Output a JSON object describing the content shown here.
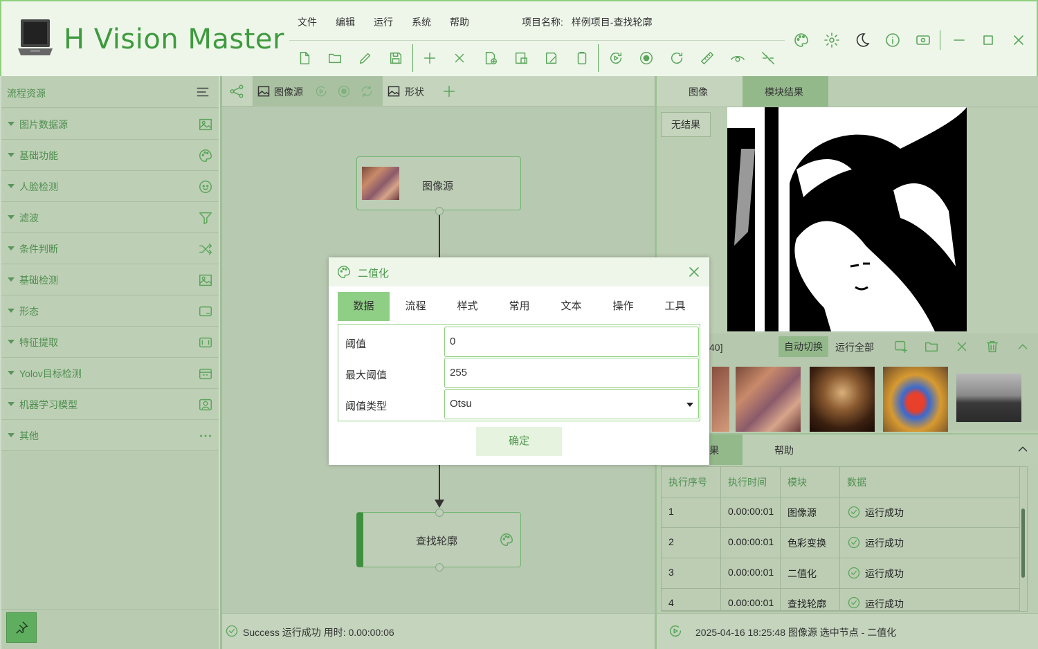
{
  "app": {
    "title": "H Vision Master",
    "project_label": "项目名称:",
    "project_name": "样例项目-查找轮廓"
  },
  "menu": [
    "文件",
    "编辑",
    "运行",
    "系统",
    "帮助"
  ],
  "left_panel": {
    "title": "流程资源",
    "categories": [
      "图片数据源",
      "基础功能",
      "人脸检测",
      "滤波",
      "条件判断",
      "基础检测",
      "形态",
      "特征提取",
      "Yolov目标检测",
      "机器学习模型",
      "其他"
    ]
  },
  "center": {
    "tabs": [
      "图像源",
      "形状"
    ],
    "nodes": {
      "source": "图像源",
      "find_contour": "查找轮廓"
    },
    "status": "Success 运行成功 用时: 0.00:00:06"
  },
  "right": {
    "tabs": [
      "图像",
      "模块结果"
    ],
    "no_result": "无结果",
    "counter": "40]",
    "auto_switch": "自动切换",
    "run_all": "运行全部",
    "result_tabs": [
      "果",
      "帮助"
    ],
    "table": {
      "headers": [
        "执行序号",
        "执行时间",
        "模块",
        "数据"
      ],
      "rows": [
        [
          "1",
          "0.00:00:01",
          "图像源",
          "运行成功"
        ],
        [
          "2",
          "0.00:00:01",
          "色彩变换",
          "运行成功"
        ],
        [
          "3",
          "0.00:00:01",
          "二值化",
          "运行成功"
        ],
        [
          "4",
          "0.00:00:01",
          "查找轮廓",
          "运行成功"
        ]
      ]
    },
    "status": "2025-04-16 18:25:48 图像源 选中节点 - 二值化"
  },
  "dialog": {
    "title": "二值化",
    "tabs": [
      "数据",
      "流程",
      "样式",
      "常用",
      "文本",
      "操作",
      "工具"
    ],
    "fields": [
      {
        "label": "阈值",
        "value": "0"
      },
      {
        "label": "最大阈值",
        "value": "255"
      },
      {
        "label": "阈值类型",
        "value": "Otsu"
      }
    ],
    "ok": "确定"
  },
  "colors": {
    "accent": "#5aa55a",
    "title_text": "#3f9a3f",
    "panel_bg": "#b9ccb1"
  }
}
